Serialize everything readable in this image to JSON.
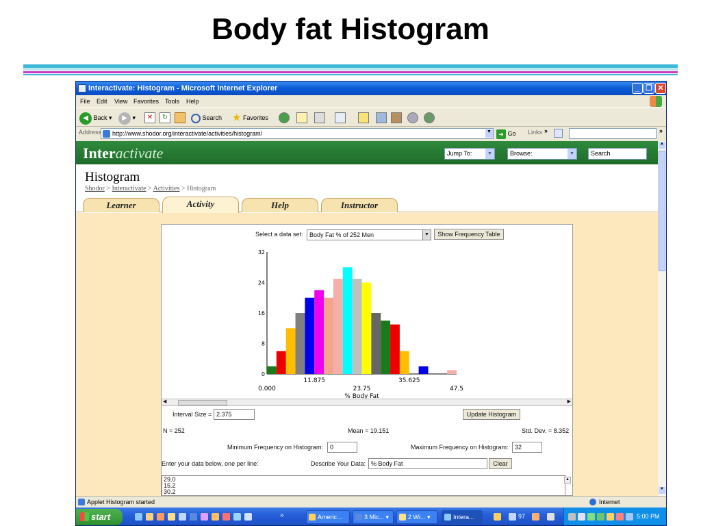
{
  "slide": {
    "title": "Body fat Histogram",
    "rule_colors": [
      "#3fb8d8",
      "#b8e6f2",
      "#c83cc8",
      "#3fb8d8"
    ]
  },
  "browser": {
    "window_title": "Interactivate: Histogram - Microsoft Internet Explorer",
    "menu": [
      "File",
      "Edit",
      "View",
      "Favorites",
      "Tools",
      "Help"
    ],
    "toolbar": {
      "back": "Back",
      "search": "Search",
      "favorites": "Favorites"
    },
    "address_label": "Address",
    "url": "http://www.shodor.org/interactivate/activities/histogram/",
    "go": "Go",
    "links": "Links",
    "status_text": "Applet Histogram started",
    "zone": "Internet"
  },
  "site": {
    "logo_bold": "Inter",
    "logo_italic": "activate",
    "jump_to": "Jump To:",
    "browse": "Browse:",
    "search": "Search",
    "page_title": "Histogram",
    "breadcrumb": [
      "Shodor",
      "Interactivate",
      "Activities",
      "Histogram"
    ],
    "tabs": [
      {
        "label": "Learner",
        "active": false
      },
      {
        "label": "Activity",
        "active": true
      },
      {
        "label": "Help",
        "active": false
      },
      {
        "label": "Instructor",
        "active": false
      }
    ]
  },
  "applet": {
    "select_label": "Select a data set:",
    "dataset": "Body Fat % of 252 Men",
    "show_table_button": "Show Frequency Table",
    "interval_label": "Interval Size =",
    "interval_value": "2.375",
    "update_button": "Update Histogram",
    "n_text": "N = 252",
    "mean_text": "Mean = 19.151",
    "sd_text": "Std. Dev. = 8.352",
    "min_freq_label": "Minimum Frequency on Histogram:",
    "min_freq_value": "0",
    "max_freq_label": "Maximum Frequency on Histogram:",
    "max_freq_value": "32",
    "enter_data_label": "Enter your data below, one per line:",
    "describe_label": "Describe Your Data:",
    "describe_value": "% Body Fat",
    "clear_button": "Clear",
    "data_lines": [
      "29.0",
      "15.2",
      "30.2"
    ]
  },
  "chart_data": {
    "type": "bar",
    "title": "",
    "xlabel": "% Body Fat",
    "ylabel": "",
    "xlim": [
      0,
      47.5
    ],
    "ylim": [
      0,
      32
    ],
    "bin_width": 2.375,
    "bin_starts": [
      0,
      2.375,
      4.75,
      7.125,
      9.5,
      11.875,
      14.25,
      16.625,
      19.0,
      21.375,
      23.75,
      26.125,
      28.5,
      30.875,
      33.25,
      35.625,
      38.0,
      40.375,
      42.75,
      45.125
    ],
    "values": [
      2,
      6,
      12,
      16,
      20,
      22,
      20,
      25,
      28,
      25,
      24,
      16,
      14,
      13,
      6,
      0,
      2,
      0,
      0,
      1
    ],
    "colors": [
      "#1a7a1a",
      "#ee0000",
      "#ffbf00",
      "#808080",
      "#0000ee",
      "#ee00ee",
      "#f4a38c",
      "#f4b0a8",
      "#00ffff",
      "#c0c0c0",
      "#ffff00",
      "#666666",
      "#1a7a1a",
      "#ee0000",
      "#ffbf00",
      "#808080",
      "#0000ee",
      "#ee00ee",
      "#f4a38c",
      "#f4b0a8"
    ],
    "y_ticks": [
      "0",
      "8",
      "16",
      "24",
      "32"
    ],
    "x_ticks_lower": [
      "0.000",
      "23.75",
      "47.5"
    ],
    "x_ticks_upper": [
      "11.875",
      "35.625"
    ],
    "grid": false
  },
  "taskbar": {
    "start": "start",
    "tasks": [
      "Americ...",
      "3 Mic...",
      "2 Wi...",
      "Intera..."
    ],
    "tray_count": "97",
    "clock": "5:00 PM"
  }
}
